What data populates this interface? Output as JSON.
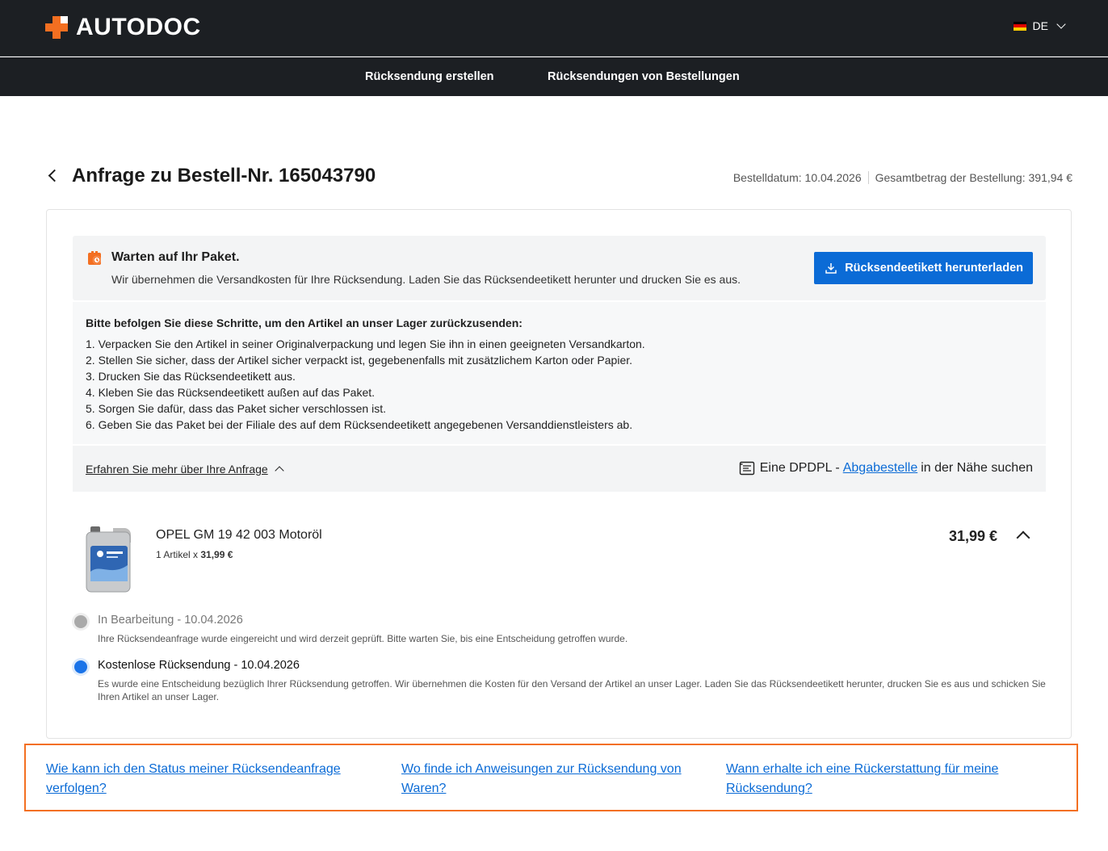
{
  "header": {
    "logo_text": "AUTODOC",
    "language": "DE",
    "brand_color": "#f36f21"
  },
  "nav": {
    "items": [
      {
        "label": "Rücksendung erstellen"
      },
      {
        "label": "Rücksendungen von Bestellungen"
      }
    ]
  },
  "page": {
    "title": "Anfrage zu Bestell-Nr. 165043790",
    "order_date": "Bestelldatum: 10.04.2026",
    "order_total": "Gesamtbetrag der Bestellung: 391,94 €"
  },
  "status": {
    "title": "Warten auf Ihr Paket.",
    "text": "Wir übernehmen die Versandkosten für Ihre Rücksendung. Laden Sie das Rücksendeetikett herunter und drucken Sie es aus.",
    "download_label": "Rücksendeetikett herunterladen",
    "accent_color": "#0b6bd6"
  },
  "steps": {
    "title": "Bitte befolgen Sie diese Schritte, um den Artikel an unser Lager zurückzusenden:",
    "items": [
      "1. Verpacken Sie den Artikel in seiner Originalverpackung und legen Sie ihn in einen geeigneten Versandkarton.",
      "2. Stellen Sie sicher, dass der Artikel sicher verpackt ist, gegebenenfalls mit zusätzlichem Karton oder Papier.",
      "3. Drucken Sie das Rücksendeetikett aus.",
      "4. Kleben Sie das Rücksendeetikett außen auf das Paket.",
      "5. Sorgen Sie dafür, dass das Paket sicher verschlossen ist.",
      "6. Geben Sie das Paket bei der Filiale des auf dem Rücksendeetikett angegebenen Versanddienstleisters ab."
    ]
  },
  "more": {
    "link_label": "Erfahren Sie mehr über Ihre Anfrage",
    "dpd_prefix": "Eine DPDPL -",
    "dpd_link": "Abgabestelle",
    "dpd_suffix": "in der Nähe suchen"
  },
  "product": {
    "name": "OPEL GM 19 42 003 Motoröl",
    "qty_prefix": "1 Artikel x",
    "qty_price": "31,99 €",
    "price": "31,99 €"
  },
  "timeline": [
    {
      "title": "In Bearbeitung - 10.04.2026",
      "desc": "Ihre Rücksendeanfrage wurde eingereicht und wird derzeit geprüft. Bitte warten Sie, bis eine Entscheidung getroffen wurde.",
      "dot_color": "#a9a9a9"
    },
    {
      "title": "Kostenlose Rücksendung - 10.04.2026",
      "desc": "Es wurde eine Entscheidung bezüglich Ihrer Rücksendung getroffen. Wir übernehmen die Kosten für den Versand der Artikel an unser Lager. Laden Sie das Rücksendeetikett herunter, drucken Sie es aus und schicken Sie Ihren Artikel an unser Lager.",
      "dot_color": "#1a73e8"
    }
  ],
  "faq": [
    {
      "label": "Wie kann ich den Status meiner Rücksendeanfrage verfolgen?"
    },
    {
      "label": "Wo finde ich Anweisungen zur Rücksendung von Waren?"
    },
    {
      "label": "Wann erhalte ich eine Rückerstattung für meine Rücksendung?"
    }
  ]
}
